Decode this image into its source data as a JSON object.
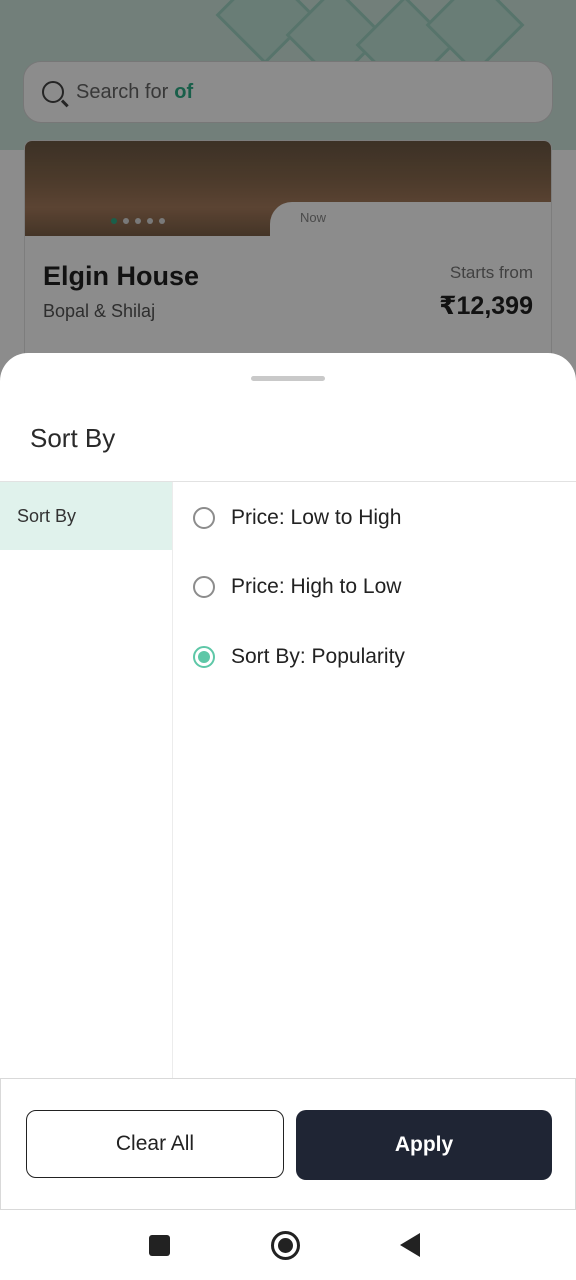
{
  "background": {
    "search": {
      "prefix": "Search for",
      "keyword": "of"
    },
    "card": {
      "badge": "Now",
      "title": "Elgin House",
      "subtitle": "Bopal & Shilaj",
      "price_label": "Starts from",
      "price": "₹12,399"
    }
  },
  "sheet": {
    "title": "Sort By",
    "left_tabs": [
      {
        "label": "Sort By",
        "active": true
      }
    ],
    "options": [
      {
        "label": "Price: Low to High",
        "selected": false
      },
      {
        "label": "Price: High to Low",
        "selected": false
      },
      {
        "label": "Sort By: Popularity",
        "selected": true
      }
    ],
    "clear_label": "Clear All",
    "apply_label": "Apply"
  },
  "colors": {
    "accent": "#5ec7a7",
    "active_tab_bg": "#e0f2ec",
    "apply_bg": "#1f2534"
  },
  "navbar": {
    "icons": [
      "recents-square-icon",
      "home-circle-icon",
      "back-triangle-icon"
    ]
  }
}
